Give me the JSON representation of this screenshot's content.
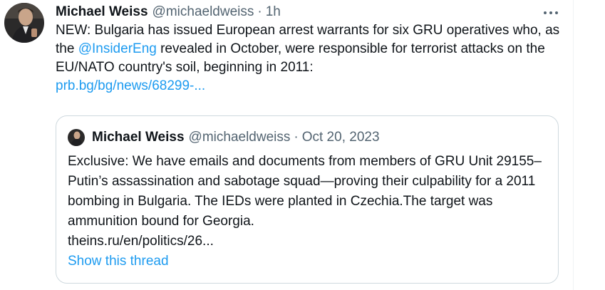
{
  "tweet": {
    "author_name": "Michael Weiss",
    "handle": "@michaeldweiss",
    "separator": "·",
    "time": "1h",
    "text_part1": "NEW: Bulgaria has issued European arrest warrants for six GRU operatives who, as the ",
    "mention": "@InsiderEng",
    "text_part2": " revealed in October, were responsible for terrorist attacks on the EU/NATO country's soil, beginning in 2011:",
    "link": "prb.bg/bg/news/68299-...",
    "more_icon": "more-horizontal-icon"
  },
  "quoted": {
    "author_name": "Michael Weiss",
    "handle": "@michaeldweiss",
    "separator": "·",
    "date": "Oct 20, 2023",
    "text": "Exclusive: We have emails and documents from members of GRU Unit 29155–Putin’s assassination and sabotage squad—proving their culpability for a 2011 bombing in Bulgaria. The IEDs were planted in Czechia.The target was ammunition bound for Georgia.",
    "link": "theins.ru/en/politics/26...",
    "show_thread": "Show this thread"
  },
  "colors": {
    "accent": "#1d9bf0",
    "secondary_text": "#536471",
    "border": "#cfd9de"
  }
}
